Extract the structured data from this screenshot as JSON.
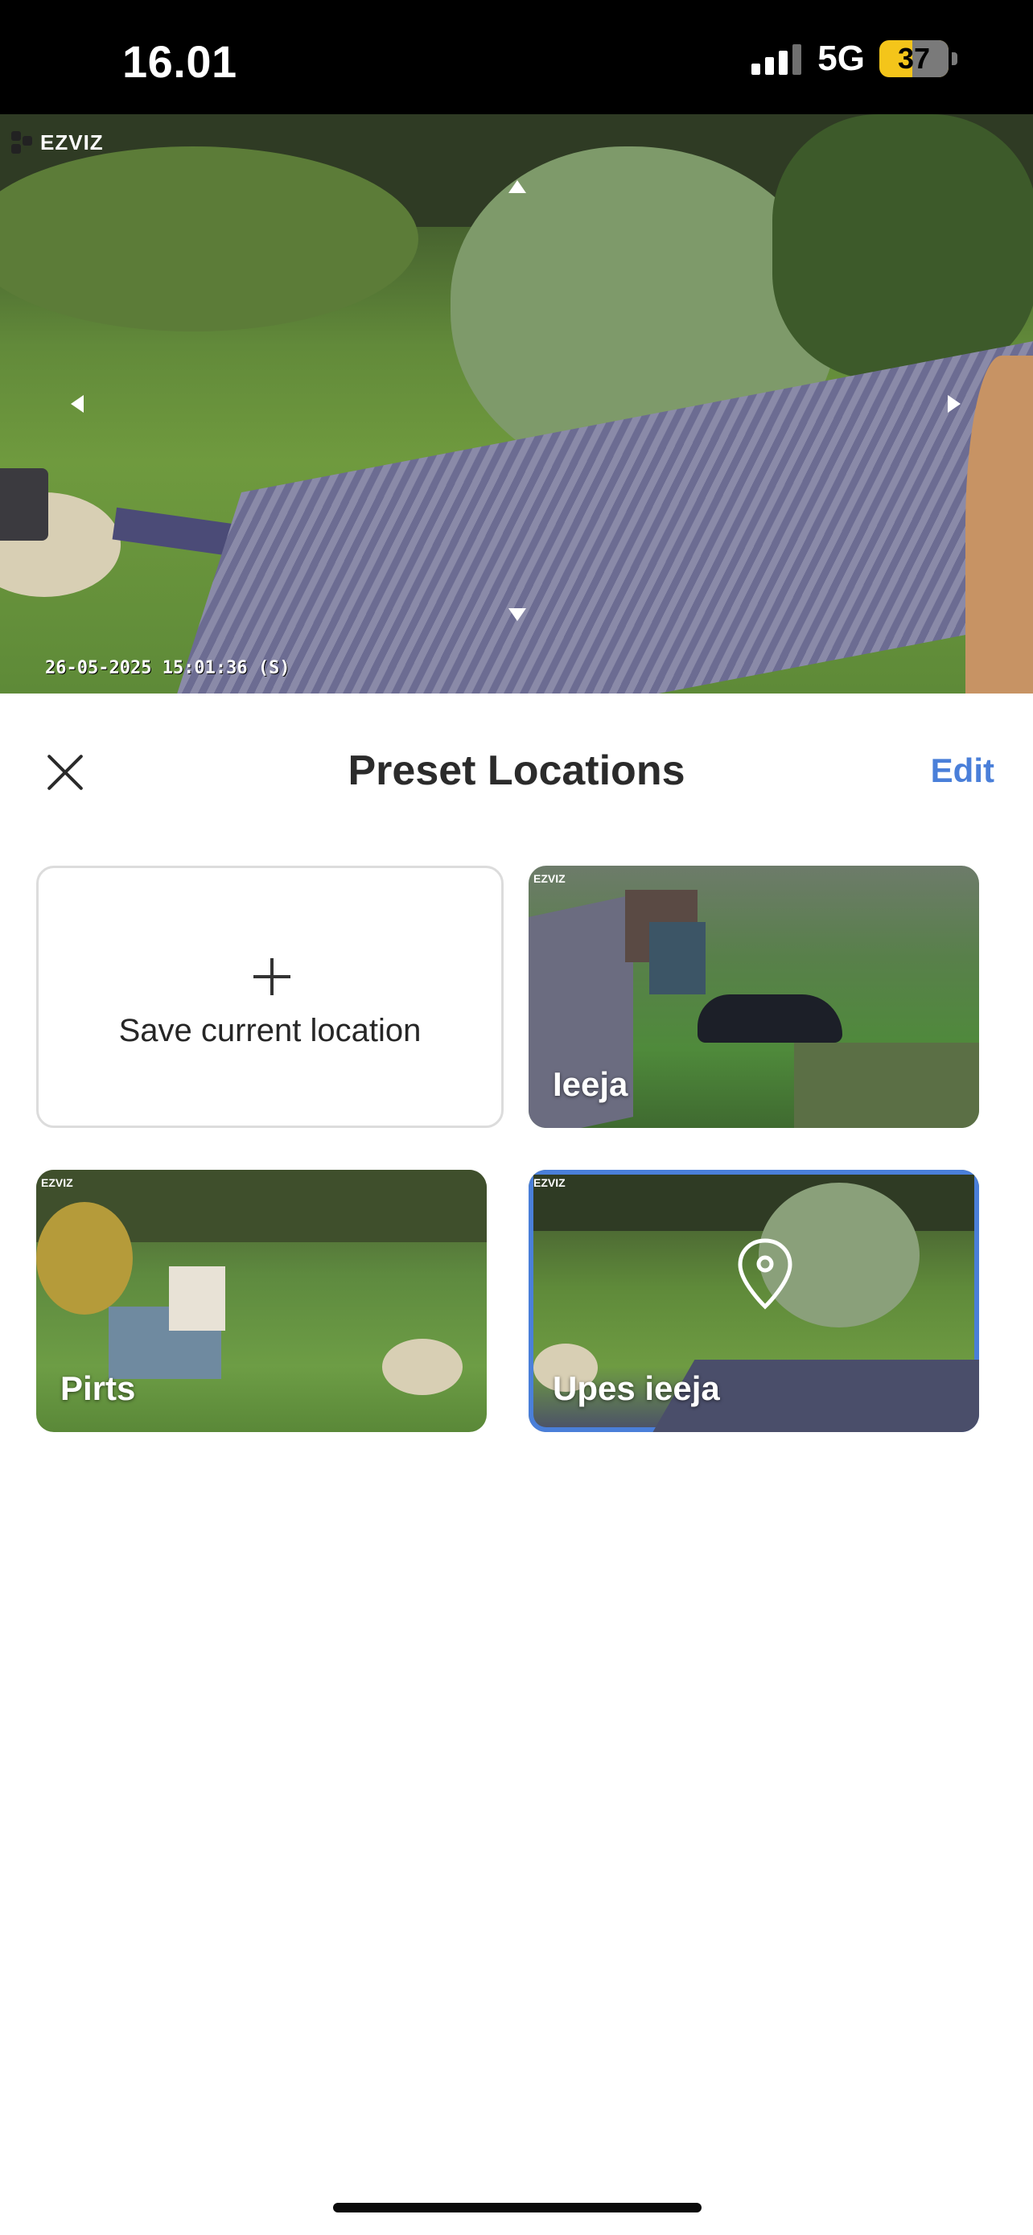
{
  "status_bar": {
    "time": "16.01",
    "network": "5G",
    "battery": "37"
  },
  "camera": {
    "logo": "EZVIZ",
    "timestamp": "26-05-2025 15:01:36 (S)"
  },
  "sheet": {
    "title": "Preset Locations",
    "edit_label": "Edit",
    "save_label": "Save current location"
  },
  "presets": [
    {
      "label": "Ieeja",
      "selected": false
    },
    {
      "label": "Pirts",
      "selected": false
    },
    {
      "label": "Upes ieeja",
      "selected": true
    }
  ],
  "colors": {
    "accent": "#4a7fd9",
    "status_bar_bg": "#000000",
    "battery": "#f4c51a"
  },
  "icons": {
    "close": "close-icon",
    "add": "plus-icon",
    "current_position": "location-pin-icon"
  }
}
